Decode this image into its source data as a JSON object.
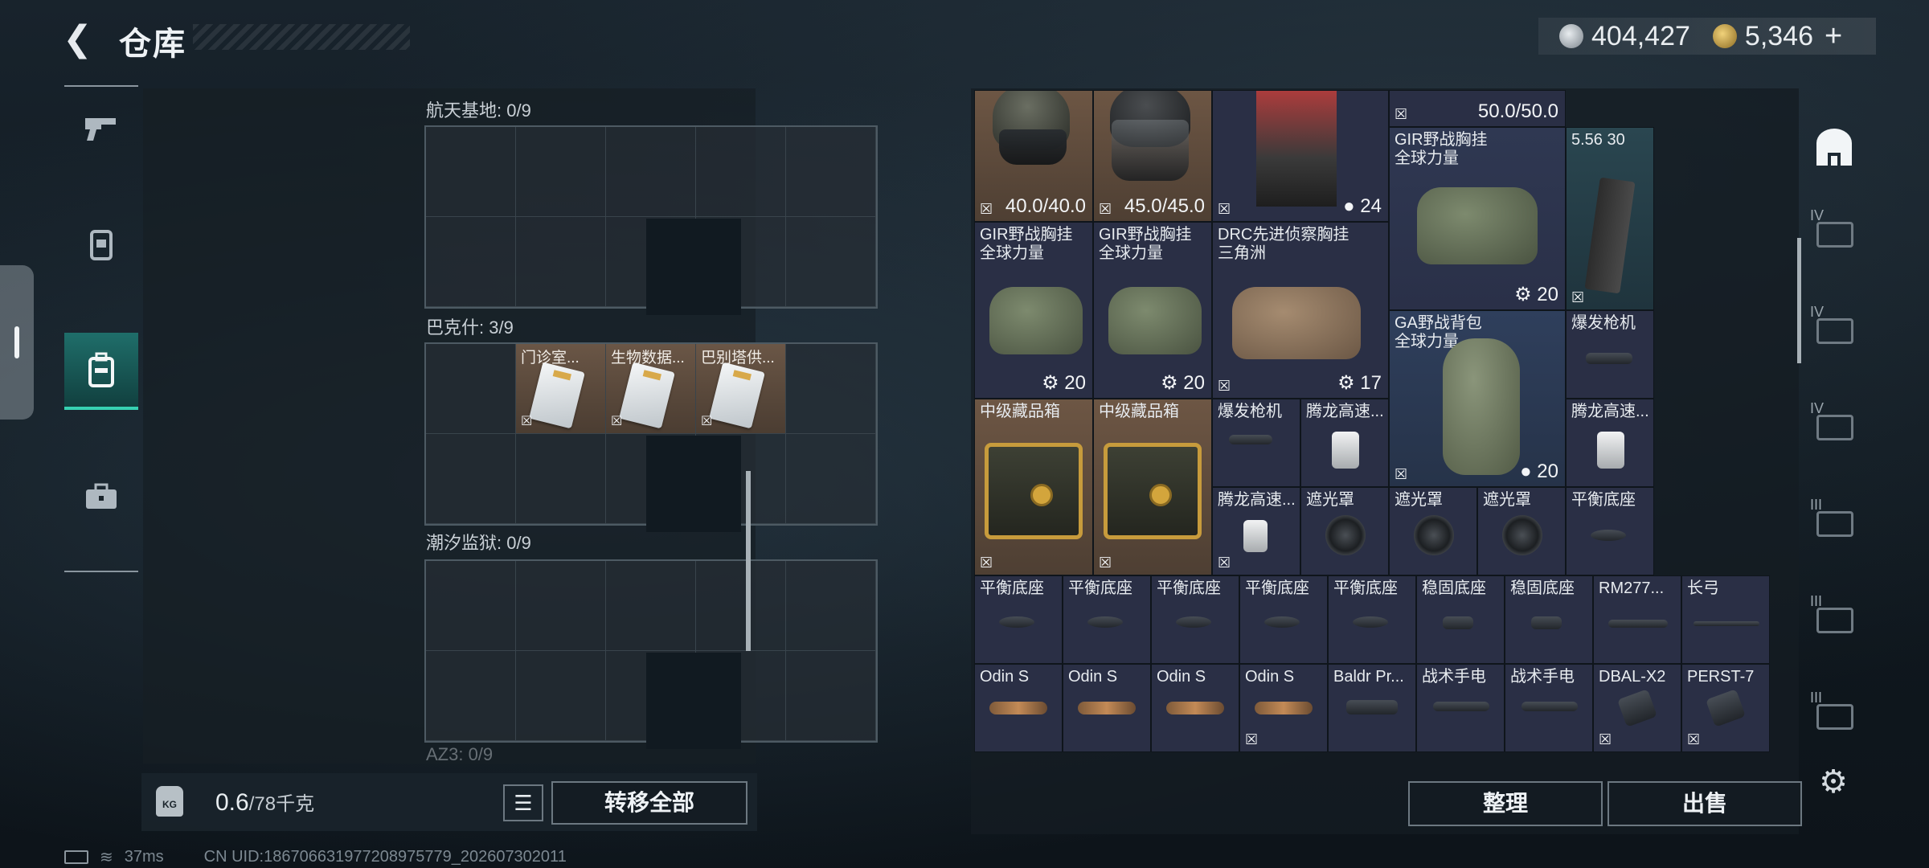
{
  "header": {
    "title": "仓库",
    "currency": [
      {
        "icon": "silver-coin-icon",
        "value": "404,427"
      },
      {
        "icon": "gold-coin-icon",
        "value": "5,346"
      }
    ],
    "add_label": "+"
  },
  "left_nav": [
    "gun-icon",
    "armor-icon",
    "backpack-icon",
    "briefcase-icon"
  ],
  "containers": [
    {
      "label": "航天基地: 0/9",
      "items": []
    },
    {
      "label": "巴克什: 3/9",
      "items": [
        "门诊室...",
        "生物数据...",
        "巴别塔供..."
      ]
    },
    {
      "label": "潮汐监狱: 0/9",
      "items": []
    },
    {
      "label": "AZ3: 0/9",
      "items": []
    }
  ],
  "weight": {
    "value": "0.6",
    "max": "/78千克",
    "icon_label": "KG"
  },
  "buttons": {
    "transfer_all": "转移全部",
    "sort": "整理",
    "sell": "出售"
  },
  "status": {
    "ping": "37ms",
    "uid": "CN UID:186706631977208975779_202607302011"
  },
  "stash": {
    "row0": {
      "helmet1_durability": "40.0/40.0",
      "helmet2_durability": "45.0/45.0",
      "chest_count": "24",
      "top_right_durability": "50.0/50.0"
    },
    "tiles": [
      {
        "name": "GIR野战胸挂",
        "sub": "全球力量",
        "count": "20"
      },
      {
        "name": "5.56 30",
        "sub": ""
      },
      {
        "name": "GIR野战胸挂",
        "sub": "全球力量",
        "count": "20"
      },
      {
        "name": "GIR野战胸挂",
        "sub": "全球力量",
        "count": "20"
      },
      {
        "name": "DRC先进侦察胸挂",
        "sub": "三角洲",
        "count": "17"
      },
      {
        "name": "GA野战背包",
        "sub": "全球力量",
        "count": "20"
      },
      {
        "name": "爆发枪机",
        "sub": ""
      },
      {
        "name": "中级藏品箱",
        "sub": ""
      },
      {
        "name": "中级藏品箱",
        "sub": ""
      },
      {
        "name": "爆发枪机",
        "sub": ""
      },
      {
        "name": "腾龙高速...",
        "sub": ""
      },
      {
        "name": "腾龙高速...",
        "sub": ""
      },
      {
        "name": "腾龙高速...",
        "sub": ""
      },
      {
        "name": "遮光罩",
        "sub": ""
      },
      {
        "name": "遮光罩",
        "sub": ""
      },
      {
        "name": "遮光罩",
        "sub": ""
      },
      {
        "name": "平衡底座",
        "sub": ""
      },
      {
        "name": "平衡底座",
        "sub": ""
      },
      {
        "name": "平衡底座",
        "sub": ""
      },
      {
        "name": "平衡底座",
        "sub": ""
      },
      {
        "name": "平衡底座",
        "sub": ""
      },
      {
        "name": "平衡底座",
        "sub": ""
      },
      {
        "name": "稳固底座",
        "sub": ""
      },
      {
        "name": "稳固底座",
        "sub": ""
      },
      {
        "name": "RM277...",
        "sub": ""
      },
      {
        "name": "长弓",
        "sub": ""
      },
      {
        "name": "Odin S",
        "sub": ""
      },
      {
        "name": "Odin S",
        "sub": ""
      },
      {
        "name": "Odin S",
        "sub": ""
      },
      {
        "name": "Odin S",
        "sub": ""
      },
      {
        "name": "Baldr Pr...",
        "sub": ""
      },
      {
        "name": "战术手电",
        "sub": ""
      },
      {
        "name": "战术手电",
        "sub": ""
      },
      {
        "name": "DBAL-X2",
        "sub": ""
      },
      {
        "name": "PERST-7",
        "sub": ""
      }
    ]
  },
  "category_nav": [
    {
      "icon": "backpack-category-icon",
      "tier": ""
    },
    {
      "icon": "weapon-category-icon",
      "tier": "IV"
    },
    {
      "icon": "container-category-icon",
      "tier": "IV"
    },
    {
      "icon": "vehicle-category-icon",
      "tier": "IV"
    },
    {
      "icon": "gun-part-category-icon",
      "tier": "III"
    },
    {
      "icon": "barrel-category-icon",
      "tier": "III"
    },
    {
      "icon": "sight-category-icon",
      "tier": "III"
    }
  ]
}
